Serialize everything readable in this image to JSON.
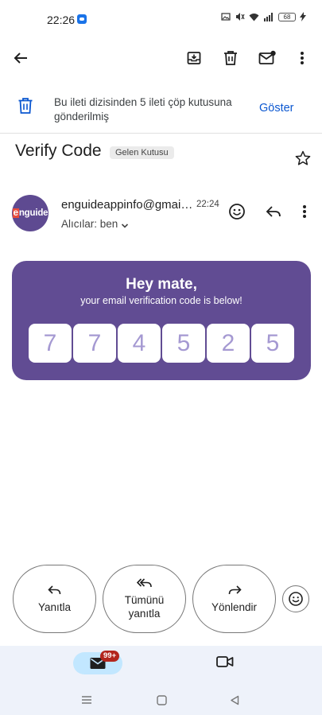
{
  "status_bar": {
    "time": "22:26",
    "battery": "68"
  },
  "notice": {
    "text": "Bu ileti dizisinden 5 ileti çöp kutusuna gönderilmiş",
    "action_label": "Göster"
  },
  "email": {
    "subject": "Verify Code",
    "label": "Gelen Kutusu",
    "sender": "enguideappinfo@gmail.com",
    "time": "22:24",
    "recipients": "Alıcılar: ben",
    "avatar_text_a": "e",
    "avatar_text_b": "nguide"
  },
  "card": {
    "title": "Hey mate,",
    "subtitle": "your email verification code is below!",
    "digits": [
      "7",
      "7",
      "4",
      "5",
      "2",
      "5"
    ]
  },
  "actions": {
    "reply": "Yanıtla",
    "reply_all_line1": "Tümünü",
    "reply_all_line2": "yanıtla",
    "forward": "Yönlendir"
  },
  "bottom_nav": {
    "mail_badge": "99+"
  },
  "colors": {
    "accent": "#0b57d0",
    "card": "#614c93",
    "digit": "#a599d2",
    "badge": "#b3261e"
  }
}
